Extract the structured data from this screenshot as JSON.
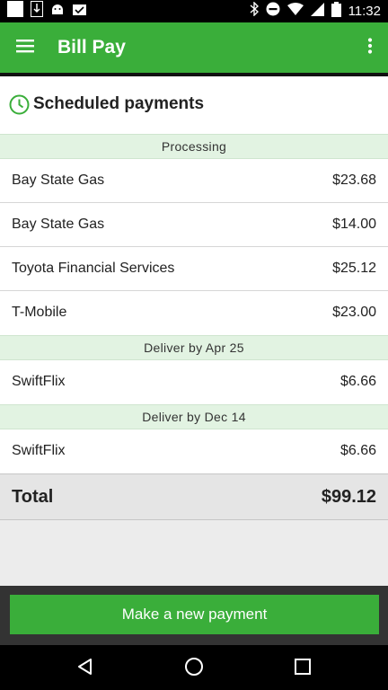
{
  "status_bar": {
    "time": "11:32"
  },
  "app_bar": {
    "title": "Bill Pay"
  },
  "section": {
    "title": "Scheduled payments"
  },
  "groups": [
    {
      "header": "Processing",
      "items": [
        {
          "name": "Bay State Gas",
          "amount": "$23.68"
        },
        {
          "name": "Bay State Gas",
          "amount": "$14.00"
        },
        {
          "name": "Toyota Financial Services",
          "amount": "$25.12"
        },
        {
          "name": "T-Mobile",
          "amount": "$23.00"
        }
      ]
    },
    {
      "header": "Deliver by Apr 25",
      "items": [
        {
          "name": "SwiftFlix",
          "amount": "$6.66"
        }
      ]
    },
    {
      "header": "Deliver by Dec 14",
      "items": [
        {
          "name": "SwiftFlix",
          "amount": "$6.66"
        }
      ]
    }
  ],
  "total": {
    "label": "Total",
    "amount": "$99.12"
  },
  "actions": {
    "make_payment": "Make a new payment"
  },
  "colors": {
    "brand_green": "#3aae3a",
    "group_header_bg": "#e2f3e2"
  }
}
